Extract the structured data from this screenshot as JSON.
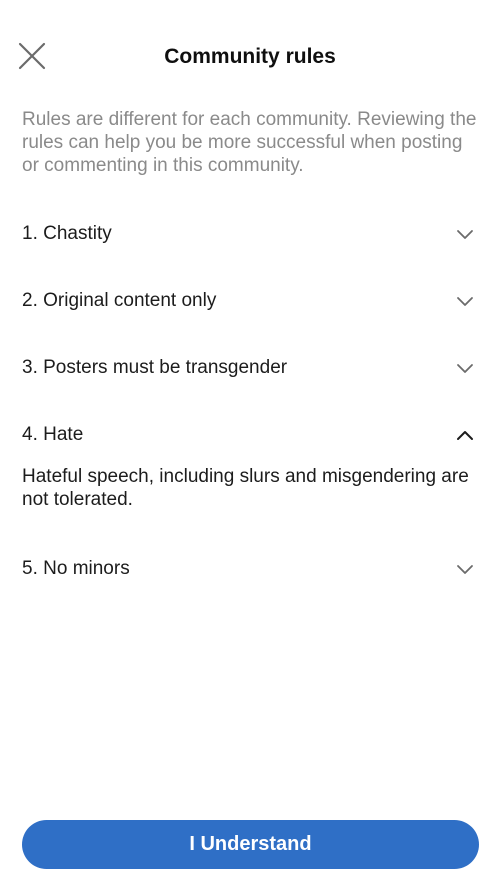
{
  "header": {
    "title": "Community rules",
    "close_icon": "close-icon"
  },
  "intro": "Rules are different for each community. Reviewing the rules can help you be more successful when posting or commenting in this community.",
  "rules": [
    {
      "title": "1. Chastity",
      "expanded": false
    },
    {
      "title": "2. Original content only",
      "expanded": false
    },
    {
      "title": "3. Posters must be transgender",
      "expanded": false
    },
    {
      "title": "4. Hate",
      "expanded": true,
      "description": "Hateful speech, including slurs and misgendering are not tolerated."
    },
    {
      "title": "5. No minors",
      "expanded": false
    }
  ],
  "footer": {
    "button_label": "I Understand"
  },
  "colors": {
    "accent": "#2f6fc6",
    "muted_text": "#8a8a8a",
    "text": "#1c1c1c"
  }
}
